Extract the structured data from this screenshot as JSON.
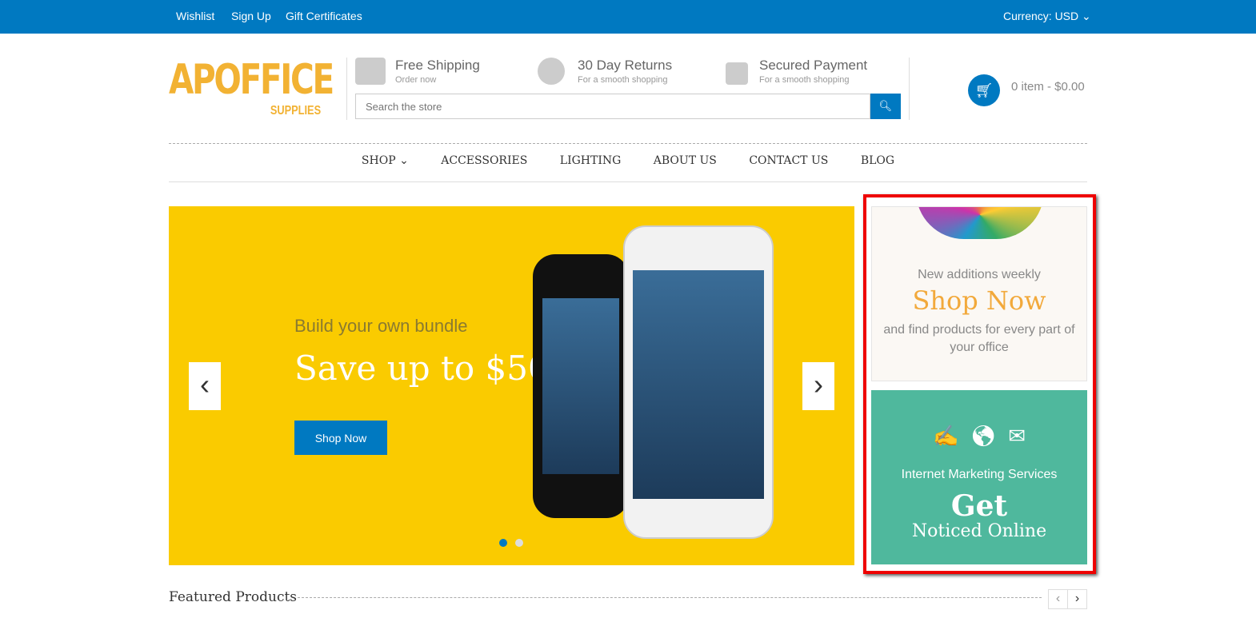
{
  "topbar": {
    "links": [
      "Wishlist",
      "Sign Up",
      "Gift Certificates"
    ],
    "currency": "Currency: USD ⌄"
  },
  "logo": {
    "main": "APOFFICE",
    "sub": "SUPPLIES"
  },
  "features": [
    {
      "title": "Free Shipping",
      "sub": "Order now",
      "icon": "truck-icon"
    },
    {
      "title": "30 Day Returns",
      "sub": "For a smooth shopping",
      "icon": "coins-icon"
    },
    {
      "title": "Secured Payment",
      "sub": "For a smooth shopping",
      "icon": "lock-icon"
    }
  ],
  "search": {
    "placeholder": "Search the store",
    "icon": "search-icon"
  },
  "cart": {
    "label": "0 item - $0.00",
    "icon": "cart-icon"
  },
  "nav": [
    "SHOP ⌄",
    "ACCESSORIES",
    "LIGHTING",
    "ABOUT US",
    "CONTACT US",
    "BLOG"
  ],
  "hero": {
    "subtitle": "Build your own bundle",
    "title": "Save up to $50",
    "button": "Shop Now",
    "prev": "‹",
    "next": "›",
    "active_slide": 1,
    "slide_count": 2
  },
  "banner1": {
    "line1": "New additions weekly",
    "line2": "Shop Now",
    "line3": "and find products for every part of your office"
  },
  "banner2": {
    "icons": [
      "pen-icon",
      "globe-icon",
      "envelope-icon"
    ],
    "line1": "Internet Marketing Services",
    "line2": "Get",
    "line3": "Noticed Online"
  },
  "featured": {
    "title": "Featured Products",
    "prev": "‹",
    "next": "›"
  },
  "colors": {
    "brand": "#0079c1",
    "logo": "#f2b233",
    "hero": "#facb00",
    "teal": "#4fb89d",
    "highlight": "#e00000"
  }
}
